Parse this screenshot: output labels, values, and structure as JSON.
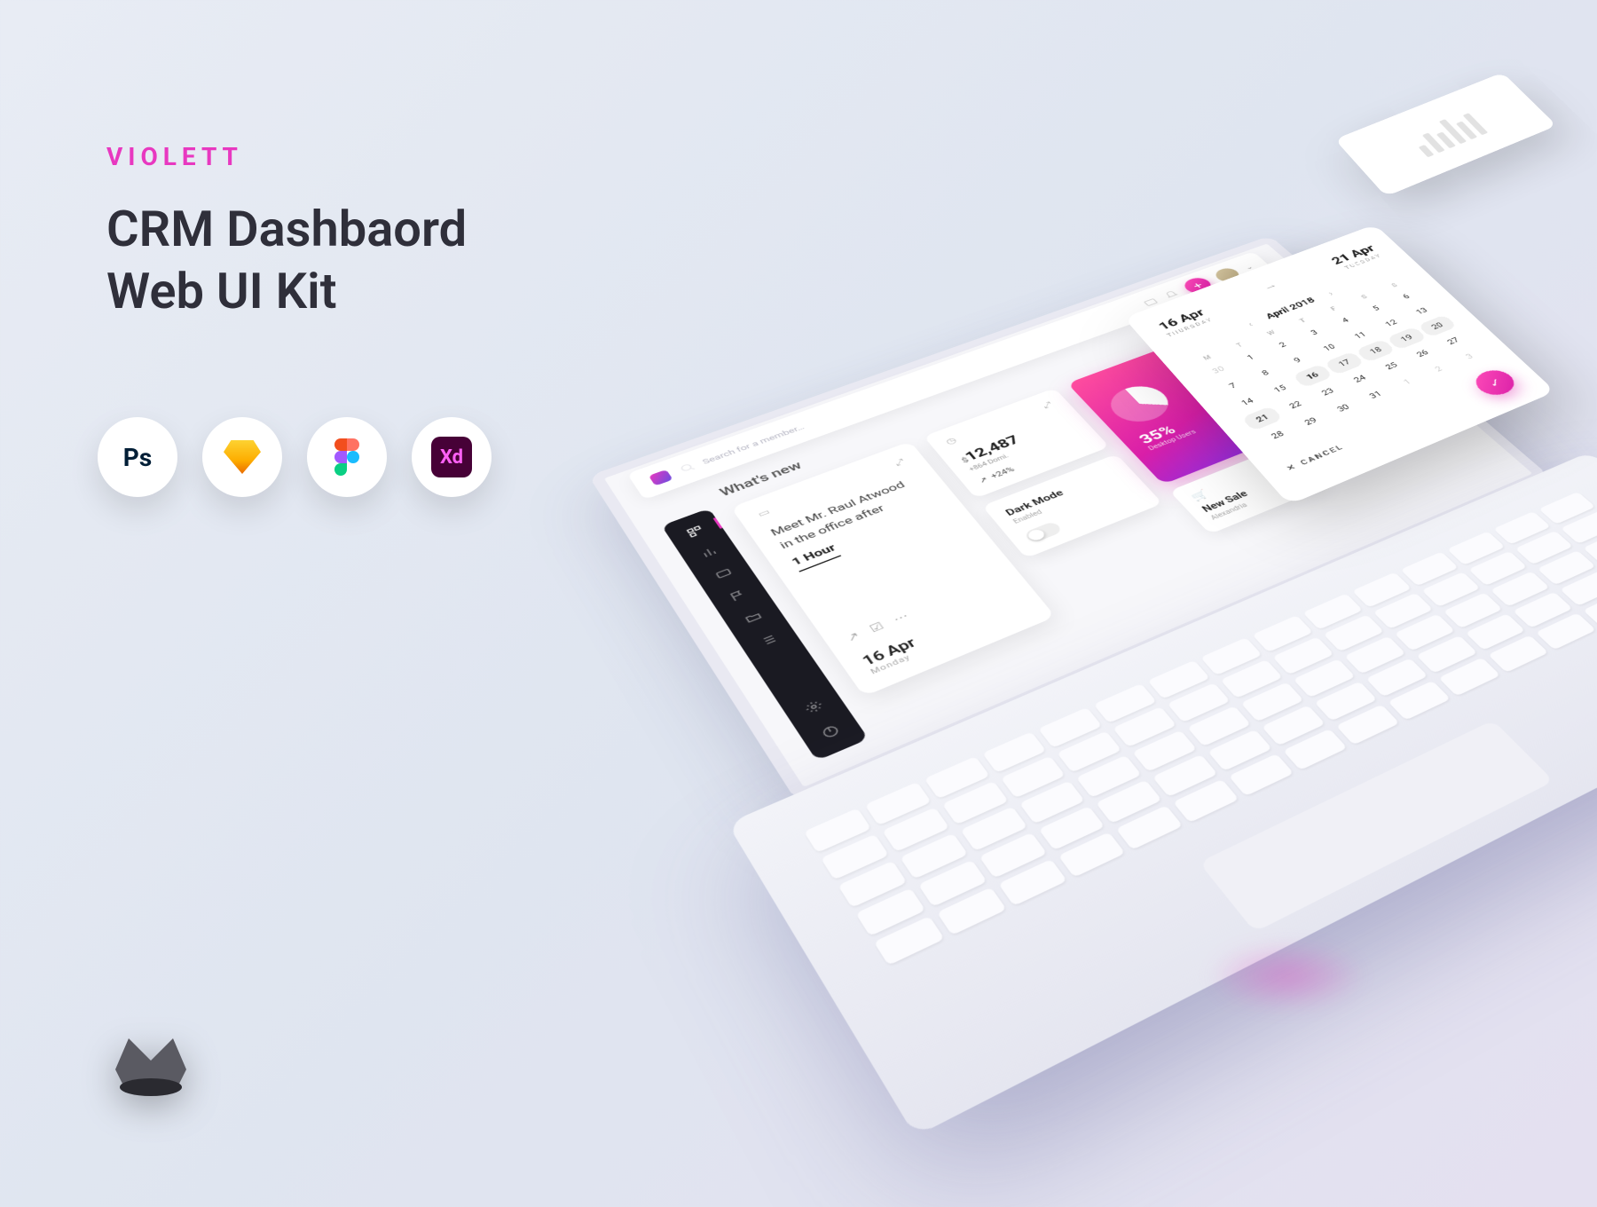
{
  "promo": {
    "brand": "VIOLETT",
    "title_line1": "CRM Dashbaord",
    "title_line2": "Web UI Kit"
  },
  "tools": {
    "ps": "Ps",
    "sketch": "Sketch",
    "figma": "Figma",
    "xd": "Xd"
  },
  "topbar": {
    "search_placeholder": "Search for a member…"
  },
  "section": {
    "title": "What's new"
  },
  "reminder": {
    "line1": "Meet Mr. Raul Atwood",
    "line2": "in the office after",
    "emphasis": "1 Hour",
    "date": "16 Apr",
    "day": "Monday"
  },
  "stat": {
    "currency": "$",
    "value": "12,487",
    "sub": "+864 Domi.",
    "trend": "+24%"
  },
  "darkmode": {
    "title": "Dark Mode",
    "status": "Enabled"
  },
  "gradient": {
    "percent": "35%",
    "label": "Desktop Users"
  },
  "sale": {
    "title": "New Sale",
    "sub": "Alexandria"
  },
  "calendar": {
    "from": "16 Apr",
    "from_day": "THURSDAY",
    "to": "21 Apr",
    "to_day": "TUESDAY",
    "month": "April 2018",
    "dows": [
      "M",
      "T",
      "W",
      "T",
      "F",
      "S",
      "S"
    ],
    "weeks": [
      [
        "30",
        "1",
        "2",
        "3",
        "4",
        "5",
        "6"
      ],
      [
        "7",
        "8",
        "9",
        "10",
        "11",
        "12",
        "13"
      ],
      [
        "14",
        "15",
        "16",
        "17",
        "18",
        "19",
        "20"
      ],
      [
        "21",
        "22",
        "23",
        "24",
        "25",
        "26",
        "27"
      ],
      [
        "28",
        "29",
        "30",
        "31",
        "1",
        "2",
        "3"
      ]
    ],
    "cancel": "CANCEL"
  },
  "colors": {
    "accent": "#e838c0",
    "gradient_start": "#ff4d9e",
    "gradient_end": "#8e2de2"
  }
}
